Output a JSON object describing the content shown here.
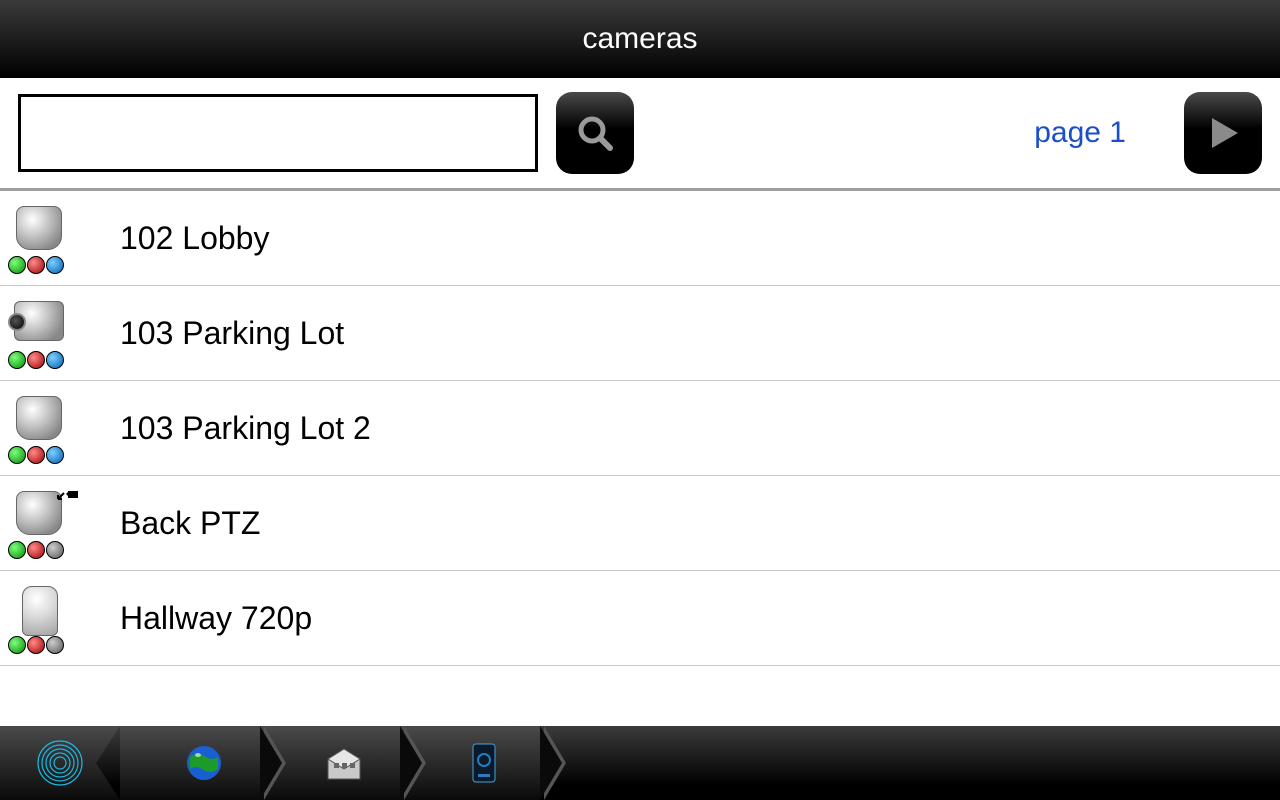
{
  "header": {
    "title": "cameras"
  },
  "toolbar": {
    "search_value": "",
    "search_placeholder": "",
    "page_label": "page 1"
  },
  "cameras": [
    {
      "name": "102 Lobby",
      "icon_type": "dome",
      "ptz": false,
      "dots": [
        "g",
        "r",
        "b"
      ]
    },
    {
      "name": "103 Parking Lot",
      "icon_type": "box",
      "ptz": false,
      "dots": [
        "g",
        "r",
        "b"
      ]
    },
    {
      "name": "103 Parking Lot 2",
      "icon_type": "dome",
      "ptz": false,
      "dots": [
        "g",
        "r",
        "b"
      ]
    },
    {
      "name": "Back PTZ",
      "icon_type": "dome",
      "ptz": true,
      "dots": [
        "g",
        "r",
        "gr"
      ]
    },
    {
      "name": "Hallway 720p",
      "icon_type": "cyl",
      "ptz": false,
      "dots": [
        "g",
        "r",
        "gr"
      ]
    }
  ],
  "bottomnav": {
    "items": [
      {
        "icon": "fingerprint"
      },
      {
        "icon": "globe"
      },
      {
        "icon": "building"
      },
      {
        "icon": "device"
      }
    ]
  }
}
